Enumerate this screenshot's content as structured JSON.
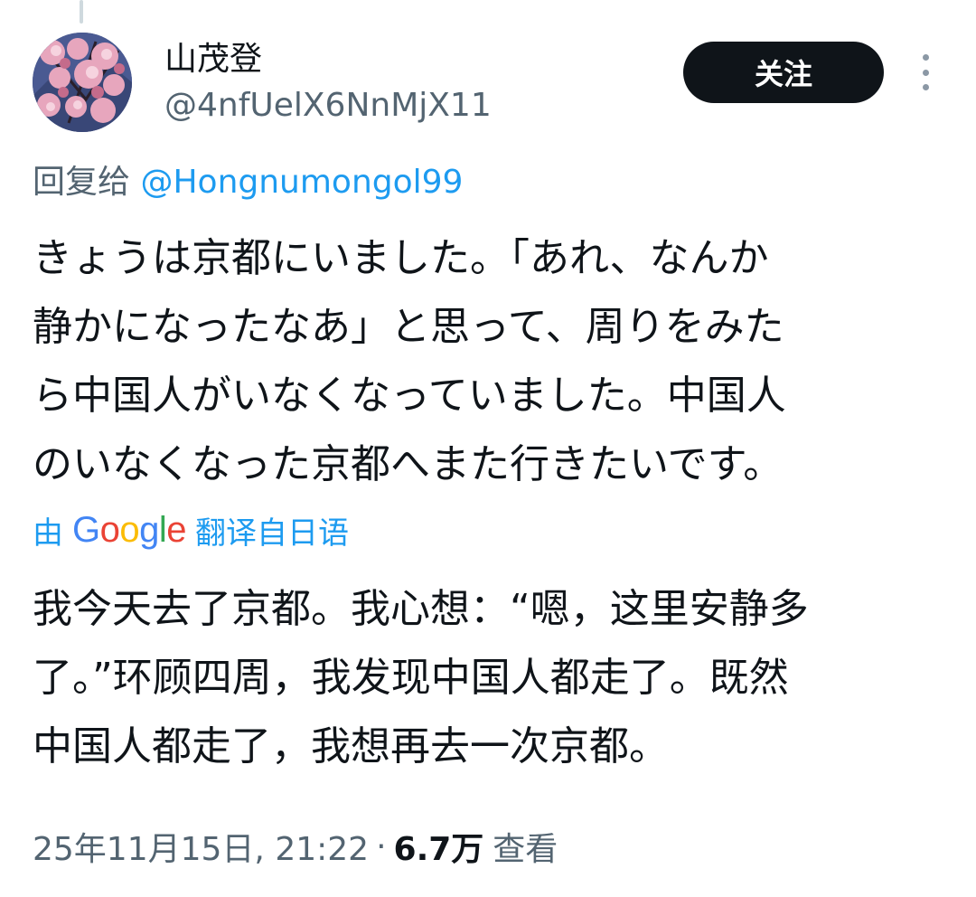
{
  "author": {
    "display_name": "山茂登",
    "handle": "@4nfUelX6NnMjX11"
  },
  "header": {
    "follow_label": "关注"
  },
  "reply": {
    "prefix": "回复给",
    "mention": "@Hongnumongol99"
  },
  "tweet": {
    "lines": [
      "きょうは京都にいました。「あれ、なんか",
      "静かになったなあ」と思って、周りをみた",
      "ら中国人がいなくなっていました。中国人",
      "のいなくなった京都へまた行きたいです。"
    ]
  },
  "translation": {
    "prefix": "由",
    "brand": [
      "G",
      "o",
      "o",
      "g",
      "l",
      "e"
    ],
    "suffix": "翻译自日语",
    "lines": [
      "我今天去了京都。我心想：“嗯，这里安静多",
      "了。”环顾四周，我发现中国人都走了。既然",
      "中国人都走了，我想再去一次京都。"
    ]
  },
  "meta": {
    "timestamp": "25年11月15日, 21:22",
    "separator": "·",
    "views_count": "6.7万",
    "views_label": "查看"
  },
  "icons": {
    "avatar": "cherry-blossom-avatar",
    "more": "more-vertical-icon"
  },
  "colors": {
    "accent": "#1d9bf0",
    "text_primary": "#0f1419",
    "text_secondary": "#536471",
    "follow_button_bg": "#0f1419"
  }
}
